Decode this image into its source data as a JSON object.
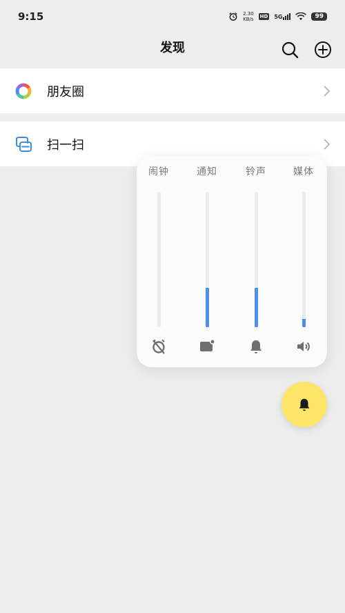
{
  "status_bar": {
    "time": "9:15",
    "net_speed_value": "2.30",
    "net_speed_unit": "KB/s",
    "hd_badge": "HD",
    "network_type": "5G",
    "battery": "99"
  },
  "nav": {
    "title": "发现",
    "icons": [
      "search-icon",
      "add-circle-icon"
    ]
  },
  "list": [
    {
      "label": "朋友圈",
      "icon": "moments-aperture-icon"
    },
    {
      "label": "扫一扫",
      "icon": "scan-icon"
    }
  ],
  "volume_panel": {
    "accent": "#4d8fe8",
    "channels": [
      {
        "label": "闹钟",
        "icon": "alarm-off-icon",
        "level": 0.0
      },
      {
        "label": "通知",
        "icon": "notification-icon",
        "level": 0.29
      },
      {
        "label": "铃声",
        "icon": "bell-icon",
        "level": 0.29
      },
      {
        "label": "媒体",
        "icon": "speaker-icon",
        "level": 0.06
      }
    ]
  },
  "ringer_button": {
    "icon": "bell-icon",
    "color": "#fde56a"
  }
}
